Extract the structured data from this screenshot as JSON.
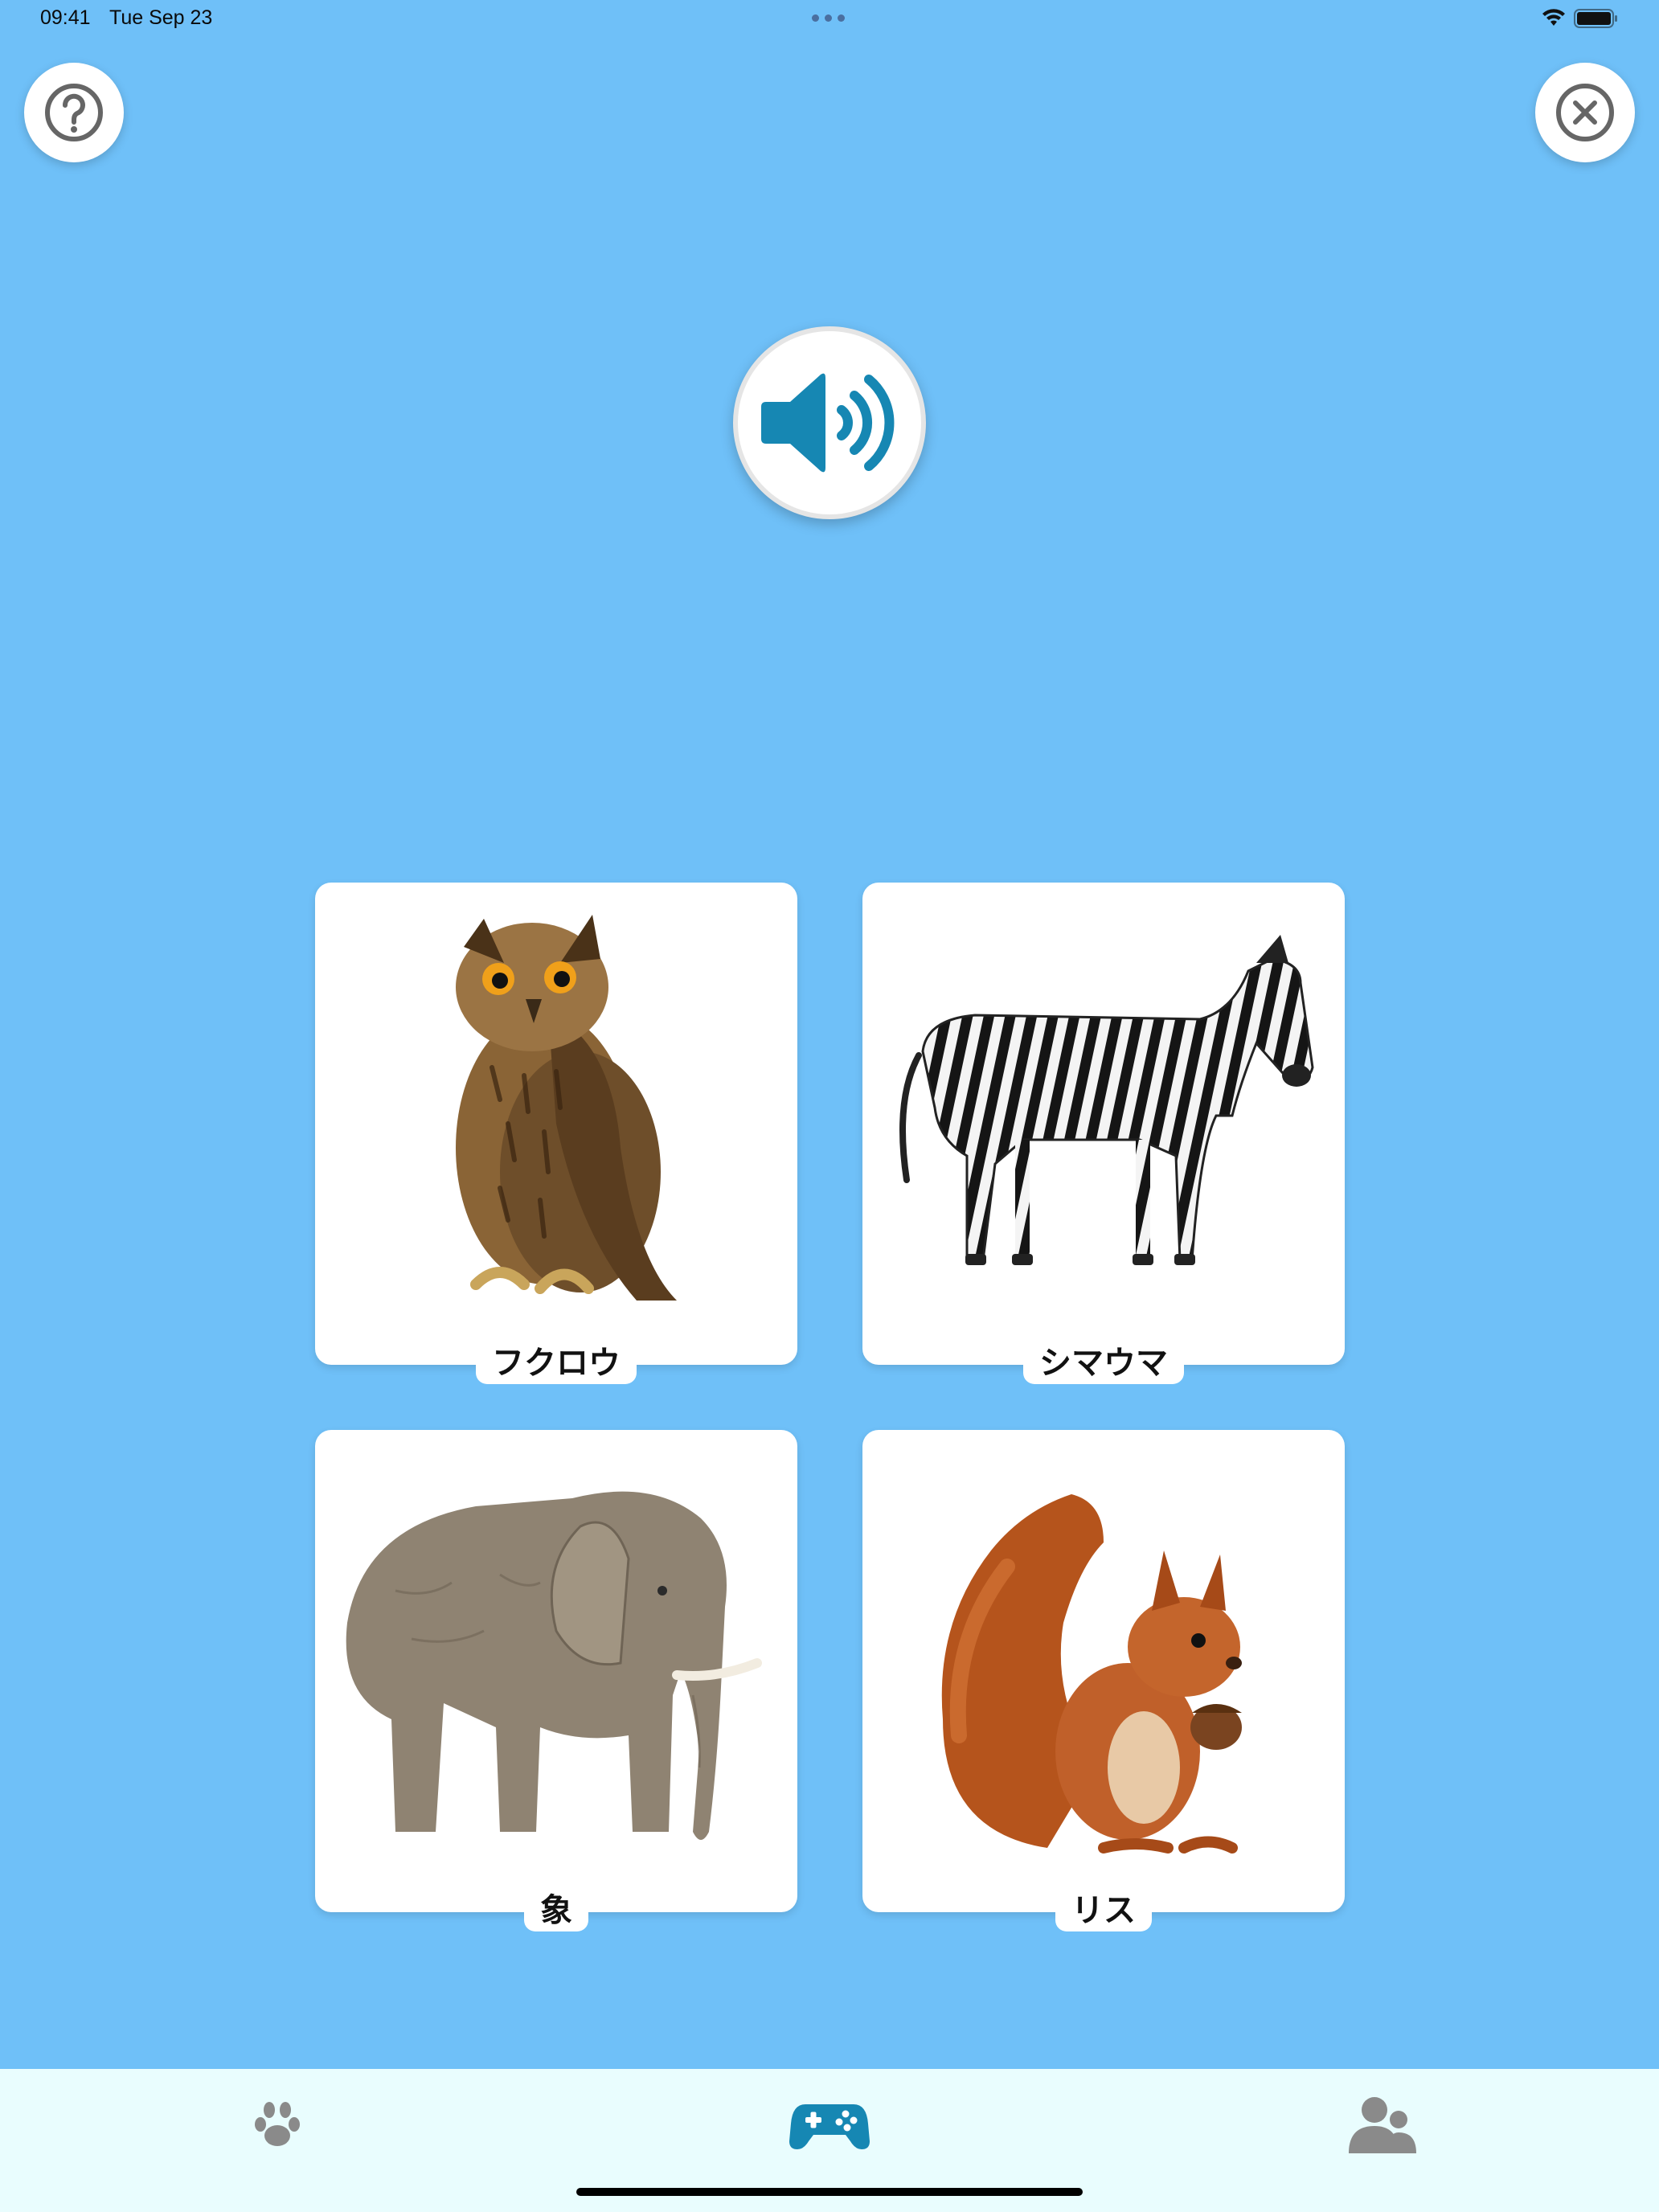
{
  "status_bar": {
    "time": "09:41",
    "date": "Tue Sep 23",
    "wifi_icon": "wifi-icon",
    "battery_icon": "battery-icon"
  },
  "top_controls": {
    "help_icon": "question-circle-icon",
    "close_icon": "close-circle-icon"
  },
  "audio": {
    "icon": "speaker-volume-icon",
    "accent_color": "#1687B3"
  },
  "cards": [
    {
      "id": "owl",
      "label": "フクロウ"
    },
    {
      "id": "zebra",
      "label": "シマウマ"
    },
    {
      "id": "elephant",
      "label": "象"
    },
    {
      "id": "squirrel",
      "label": "リス"
    }
  ],
  "tab_bar": {
    "items": [
      {
        "icon": "paw-icon",
        "active": false
      },
      {
        "icon": "gamepad-icon",
        "active": true
      },
      {
        "icon": "users-icon",
        "active": false
      }
    ],
    "active_color": "#1687B3",
    "inactive_color": "#8A8A8A"
  },
  "colors": {
    "background": "#6FC0F8",
    "tab_bar_background": "#E9FDFE"
  }
}
